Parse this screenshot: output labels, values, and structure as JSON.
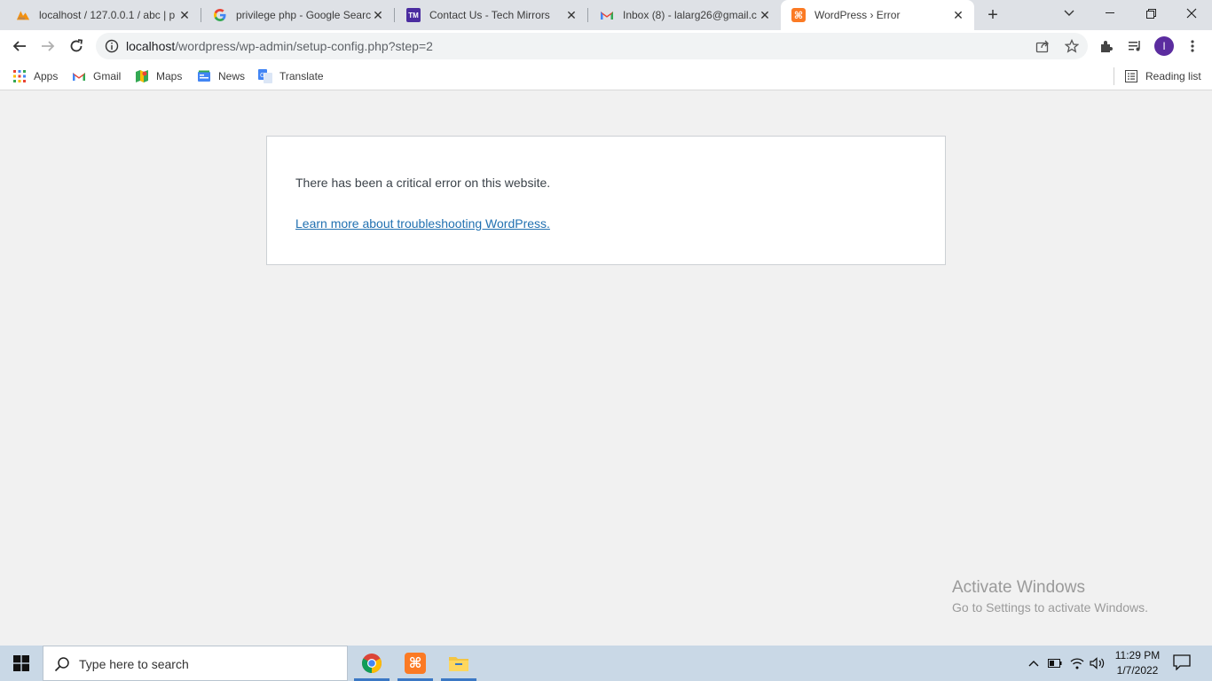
{
  "tabs": [
    {
      "title": "localhost / 127.0.0.1 / abc | p",
      "favicon": "phpmyadmin-icon",
      "active": false
    },
    {
      "title": "privilege php - Google Searc",
      "favicon": "google-icon",
      "active": false
    },
    {
      "title": "Contact Us - Tech Mirrors",
      "favicon": "techmirrors-icon",
      "favicon_text": "TM",
      "active": false
    },
    {
      "title": "Inbox (8) - lalarg26@gmail.c",
      "favicon": "gmail-icon",
      "active": false
    },
    {
      "title": "WordPress › Error",
      "favicon": "xampp-icon",
      "active": true
    }
  ],
  "toolbar": {
    "url_host": "localhost",
    "url_path": "/wordpress/wp-admin/setup-config.php?step=2",
    "avatar_letter": "I"
  },
  "bookmarks": {
    "items": [
      {
        "label": "Apps",
        "icon": "apps-grid-icon"
      },
      {
        "label": "Gmail",
        "icon": "gmail-icon"
      },
      {
        "label": "Maps",
        "icon": "maps-icon"
      },
      {
        "label": "News",
        "icon": "news-icon"
      },
      {
        "label": "Translate",
        "icon": "translate-icon"
      }
    ],
    "reading_list": "Reading list"
  },
  "page": {
    "error_message": "There has been a critical error on this website.",
    "error_link": "Learn more about troubleshooting WordPress."
  },
  "watermark": {
    "title": "Activate Windows",
    "subtitle": "Go to Settings to activate Windows."
  },
  "taskbar": {
    "search_placeholder": "Type here to search",
    "time": "11:29 PM",
    "date": "1/7/2022"
  },
  "colors": {
    "link": "#2271b1",
    "avatar": "#5b2c9f",
    "xampp": "#fb7a24",
    "techmirrors": "#4b2ca0"
  }
}
